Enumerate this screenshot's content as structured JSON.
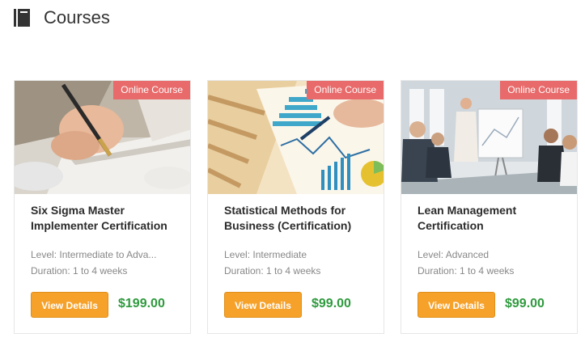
{
  "page": {
    "title": "Courses",
    "icon": "book-icon"
  },
  "courses": [
    {
      "badge": "Online Course",
      "title": "Six Sigma Master Implementer Certification",
      "level": "Level: Intermediate to Adva...",
      "duration": "Duration: 1 to 4 weeks",
      "button": "View Details",
      "price": "$199.00",
      "image": "pen-writing-photo"
    },
    {
      "badge": "Online Course",
      "title": "Statistical Methods for Business (Certification)",
      "level": "Level: Intermediate",
      "duration": "Duration: 1 to 4 weeks",
      "button": "View Details",
      "price": "$99.00",
      "image": "charts-analysis-photo"
    },
    {
      "badge": "Online Course",
      "title": "Lean Management Certification",
      "level": "Level: Advanced",
      "duration": "Duration: 1 to 4 weeks",
      "button": "View Details",
      "price": "$99.00",
      "image": "business-meeting-photo"
    }
  ],
  "colors": {
    "badge": "#e86a6a",
    "button": "#f5a12a",
    "price": "#2f9a3e"
  }
}
